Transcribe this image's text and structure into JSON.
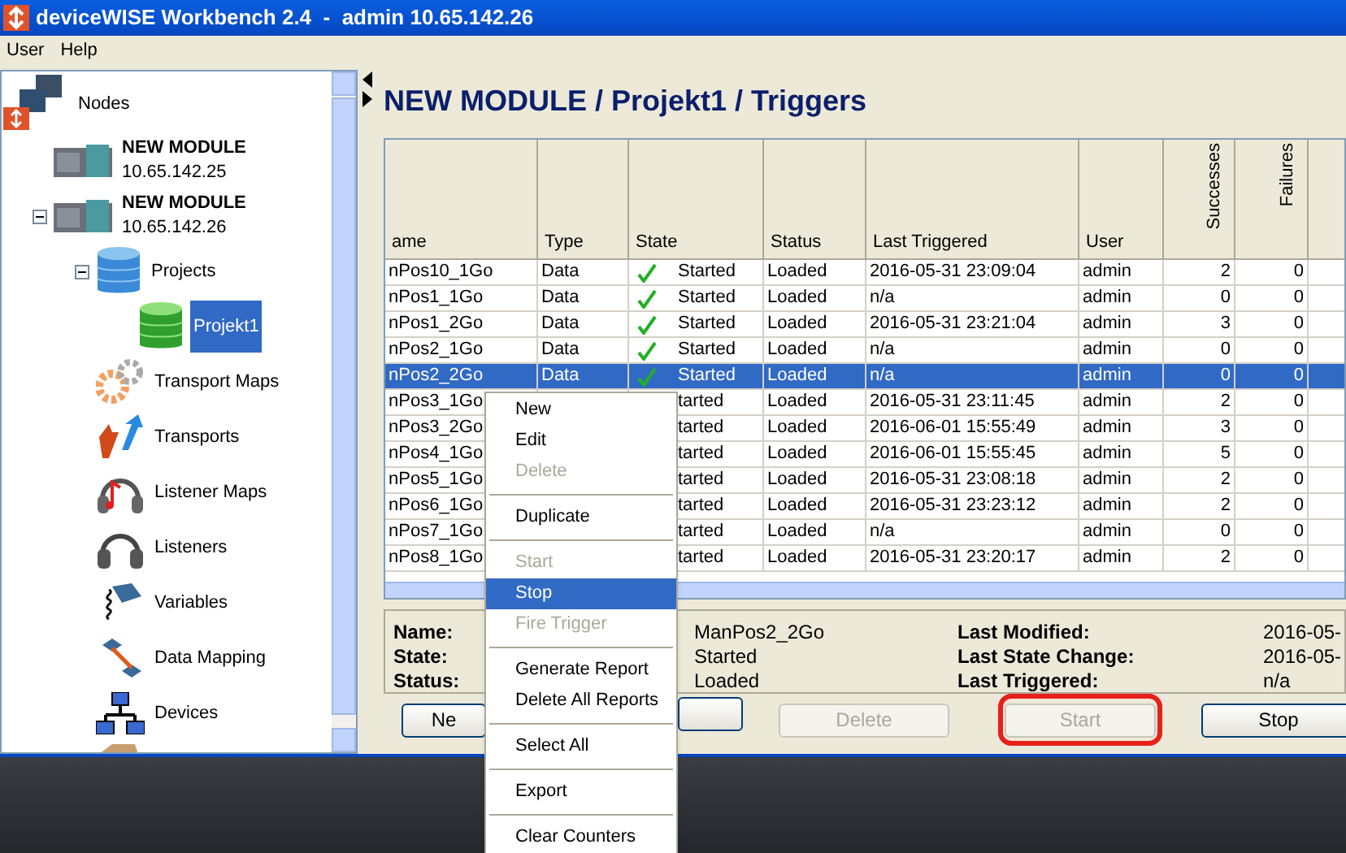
{
  "window": {
    "title": "deviceWISE Workbench 2.4  -  admin 10.65.142.26"
  },
  "menu_bar": [
    "User",
    "Help"
  ],
  "tree": [
    {
      "label": "Nodes",
      "kind": "nodes",
      "selected": false,
      "children": [
        {
          "label": "NEW MODULE",
          "sublabel": "10.65.142.25",
          "kind": "module",
          "selected": false
        },
        {
          "label": "NEW MODULE",
          "sublabel": "10.65.142.26",
          "kind": "module",
          "selected": false,
          "expanded": true,
          "children": [
            {
              "label": "Projects",
              "kind": "projects",
              "selected": false,
              "expanded": true,
              "children": [
                {
                  "label": "Projekt1",
                  "kind": "project",
                  "selected": true
                }
              ]
            },
            {
              "label": "Transport Maps",
              "kind": "gears",
              "selected": false
            },
            {
              "label": "Transports",
              "kind": "arrows",
              "selected": false
            },
            {
              "label": "Listener Maps",
              "kind": "music",
              "selected": false
            },
            {
              "label": "Listeners",
              "kind": "headphones",
              "selected": false
            },
            {
              "label": "Variables",
              "kind": "variables",
              "selected": false
            },
            {
              "label": "Data Mapping",
              "kind": "mapping",
              "selected": false
            },
            {
              "label": "Devices",
              "kind": "network",
              "selected": false
            },
            {
              "kind": "partial"
            }
          ]
        }
      ]
    }
  ],
  "heading": "NEW MODULE / Projekt1 / Triggers",
  "table": {
    "columns": [
      "ame",
      "Type",
      "State",
      "Status",
      "Last Triggered",
      "User",
      "Successes",
      "Failures"
    ],
    "rows": [
      {
        "name": "nPos10_1Go",
        "type": "Data",
        "check": true,
        "state": "Started",
        "status": "Loaded",
        "last": "2016-05-31 23:09:04",
        "user": "admin",
        "successes": "2",
        "failures": "0",
        "selected": false
      },
      {
        "name": "nPos1_1Go",
        "type": "Data",
        "check": true,
        "state": "Started",
        "status": "Loaded",
        "last": "n/a",
        "user": "admin",
        "successes": "0",
        "failures": "0",
        "selected": false
      },
      {
        "name": "nPos1_2Go",
        "type": "Data",
        "check": true,
        "state": "Started",
        "status": "Loaded",
        "last": "2016-05-31 23:21:04",
        "user": "admin",
        "successes": "3",
        "failures": "0",
        "selected": false
      },
      {
        "name": "nPos2_1Go",
        "type": "Data",
        "check": true,
        "state": "Started",
        "status": "Loaded",
        "last": "n/a",
        "user": "admin",
        "successes": "0",
        "failures": "0",
        "selected": false
      },
      {
        "name": "nPos2_2Go",
        "type": "Data",
        "check": true,
        "state": "Started",
        "status": "Loaded",
        "last": "n/a",
        "user": "admin",
        "successes": "0",
        "failures": "0",
        "selected": true
      },
      {
        "name": "nPos3_1Go",
        "state": "tarted",
        "status": "Loaded",
        "last": "2016-05-31 23:11:45",
        "user": "admin",
        "successes": "2",
        "failures": "0",
        "selected": false
      },
      {
        "name": "nPos3_2Go",
        "state": "tarted",
        "status": "Loaded",
        "last": "2016-06-01 15:55:49",
        "user": "admin",
        "successes": "3",
        "failures": "0",
        "selected": false
      },
      {
        "name": "nPos4_1Go",
        "state": "tarted",
        "status": "Loaded",
        "last": "2016-06-01 15:55:45",
        "user": "admin",
        "successes": "5",
        "failures": "0",
        "selected": false
      },
      {
        "name": "nPos5_1Go",
        "state": "tarted",
        "status": "Loaded",
        "last": "2016-05-31 23:08:18",
        "user": "admin",
        "successes": "2",
        "failures": "0",
        "selected": false
      },
      {
        "name": "nPos6_1Go",
        "state": "tarted",
        "status": "Loaded",
        "last": "2016-05-31 23:23:12",
        "user": "admin",
        "successes": "2",
        "failures": "0",
        "selected": false
      },
      {
        "name": "nPos7_1Go",
        "state": "tarted",
        "status": "Loaded",
        "last": "n/a",
        "user": "admin",
        "successes": "0",
        "failures": "0",
        "selected": false
      },
      {
        "name": "nPos8_1Go",
        "state": "tarted",
        "status": "Loaded",
        "last": "2016-05-31 23:20:17",
        "user": "admin",
        "successes": "2",
        "failures": "0",
        "selected": false
      }
    ]
  },
  "details": {
    "left": [
      {
        "label": "Name:",
        "value": "ManPos2_2Go"
      },
      {
        "label": "State:",
        "value": "Started"
      },
      {
        "label": "Status:",
        "value": "Loaded"
      }
    ],
    "right": [
      {
        "label": "Last Modified:",
        "value": "2016-05-"
      },
      {
        "label": "Last State Change:",
        "value": "2016-05-"
      },
      {
        "label": "Last Triggered:",
        "value": "n/a"
      }
    ]
  },
  "buttons": [
    {
      "label": "Ne",
      "disabled": false,
      "highlighted": false
    },
    {
      "disabled": false,
      "highlighted": false
    },
    {
      "label": "Delete",
      "disabled": true,
      "highlighted": false
    },
    {
      "label": "Start",
      "disabled": true,
      "highlighted": true
    },
    {
      "label": "Stop",
      "disabled": false,
      "highlighted": false
    }
  ],
  "context_menu": [
    {
      "kind": "item",
      "label": "New",
      "disabled": false,
      "selected": false
    },
    {
      "kind": "item",
      "label": "Edit",
      "disabled": false,
      "selected": false
    },
    {
      "kind": "item",
      "label": "Delete",
      "disabled": true,
      "selected": false
    },
    {
      "kind": "separator"
    },
    {
      "kind": "item",
      "label": "Duplicate",
      "disabled": false,
      "selected": false
    },
    {
      "kind": "separator"
    },
    {
      "kind": "item",
      "label": "Start",
      "disabled": true,
      "selected": false
    },
    {
      "kind": "item",
      "label": "Stop",
      "disabled": false,
      "selected": true
    },
    {
      "kind": "item",
      "label": "Fire Trigger",
      "disabled": true,
      "selected": false
    },
    {
      "kind": "separator"
    },
    {
      "kind": "item",
      "label": "Generate Report",
      "disabled": false,
      "selected": false
    },
    {
      "kind": "item",
      "label": "Delete All Reports",
      "disabled": false,
      "selected": false
    },
    {
      "kind": "separator"
    },
    {
      "kind": "item",
      "label": "Select All",
      "disabled": false,
      "selected": false
    },
    {
      "kind": "separator"
    },
    {
      "kind": "item",
      "label": "Export",
      "disabled": false,
      "selected": false
    },
    {
      "kind": "separator"
    },
    {
      "kind": "item",
      "label": "Clear Counters",
      "disabled": false,
      "selected": false
    }
  ]
}
